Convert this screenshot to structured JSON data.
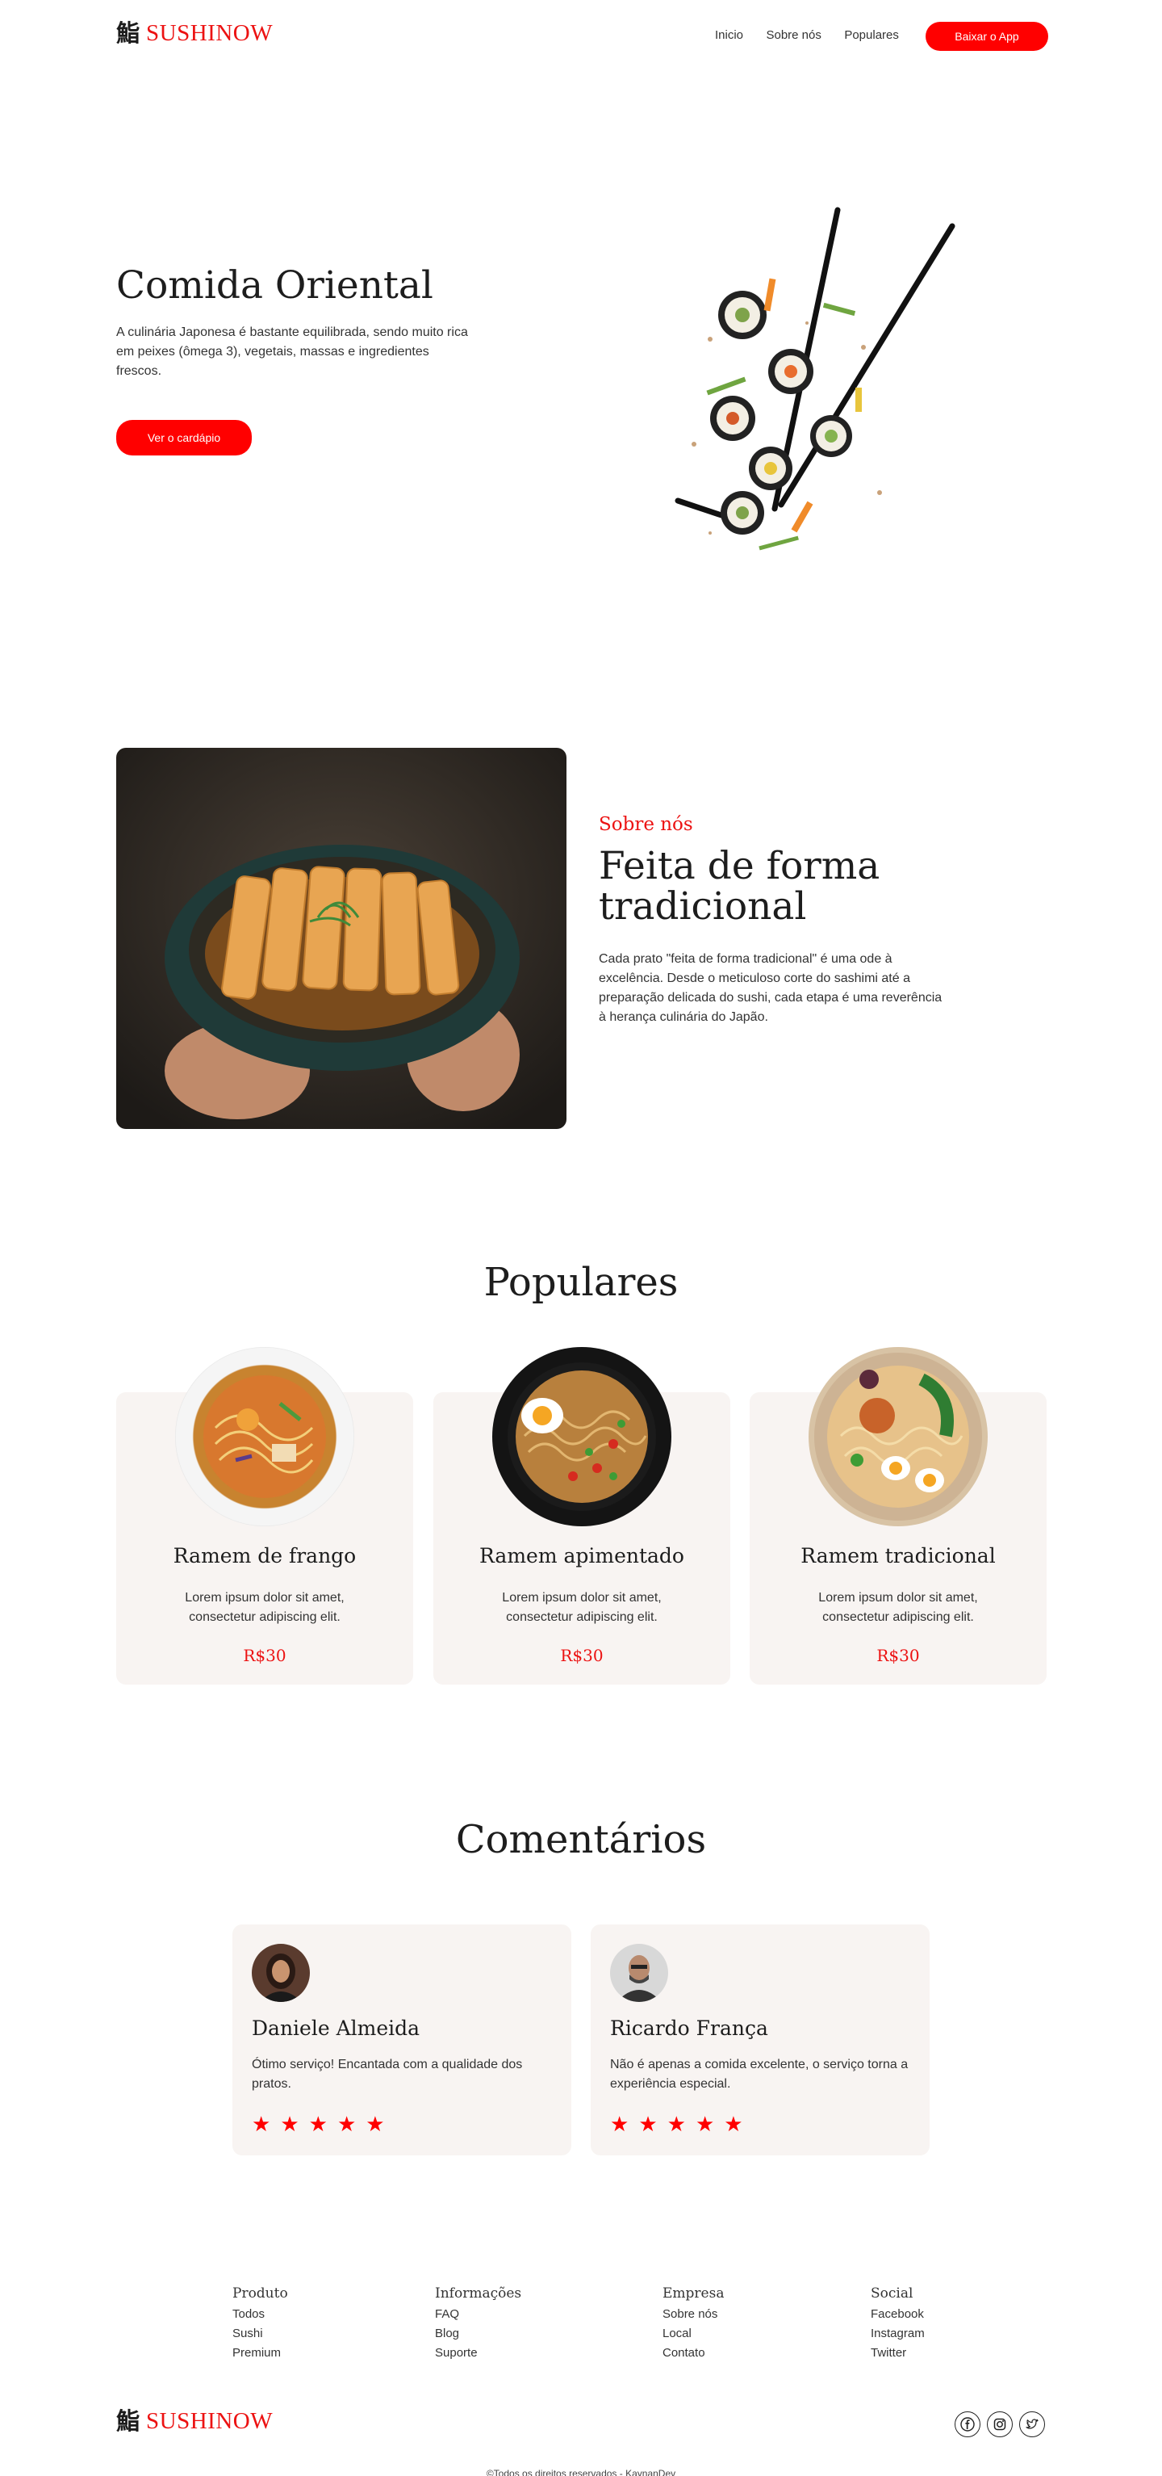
{
  "header": {
    "logo_kanji": "鮨",
    "logo_text": "SUSHINOW",
    "nav": [
      "Inicio",
      "Sobre nós",
      "Populares"
    ],
    "cta": "Baixar o App"
  },
  "hero": {
    "title": "Comida Oriental",
    "description": "A culinária Japonesa é bastante equilibrada, sendo muito rica em peixes (ômega 3), vegetais, massas e ingredientes frescos.",
    "button": "Ver o cardápio",
    "image": "sushi-chopsticks-image"
  },
  "about": {
    "kicker": "Sobre nós",
    "title": "Feita de forma tradicional",
    "description": "Cada prato \"feita de forma tradicional\" é uma ode à excelência. Desde o meticuloso corte do sashimi até a preparação delicada do sushi, cada etapa é uma reverência à herança culinária do Japão.",
    "image": "katsu-bowl-image"
  },
  "populares": {
    "title": "Populares",
    "items": [
      {
        "name": "Ramem de frango",
        "description": "Lorem ipsum dolor sit amet, consectetur adipiscing elit.",
        "price": "R$30"
      },
      {
        "name": "Ramem apimentado",
        "description": "Lorem ipsum dolor sit amet, consectetur adipiscing elit.",
        "price": "R$30"
      },
      {
        "name": "Ramem tradicional",
        "description": "Lorem ipsum dolor sit amet, consectetur adipiscing elit.",
        "price": "R$30"
      }
    ]
  },
  "comentarios": {
    "title": "Comentários",
    "items": [
      {
        "name": "Daniele Almeida",
        "text": "Ótimo serviço! Encantada com a qualidade dos pratos.",
        "rating": 5
      },
      {
        "name": "Ricardo França",
        "text": "Não é apenas a comida excelente, o serviço torna a experiência especial.",
        "rating": 5
      }
    ]
  },
  "footer": {
    "columns": [
      {
        "title": "Produto",
        "links": [
          "Todos",
          "Sushi",
          "Premium"
        ]
      },
      {
        "title": "Informações",
        "links": [
          "FAQ",
          "Blog",
          "Suporte"
        ]
      },
      {
        "title": "Empresa",
        "links": [
          "Sobre nós",
          "Local",
          "Contato"
        ]
      },
      {
        "title": "Social",
        "links": [
          "Facebook",
          "Instagram",
          "Twitter"
        ]
      }
    ],
    "social_icons": [
      "facebook-icon",
      "instagram-icon",
      "twitter-icon"
    ],
    "copyright": "©Todos os direitos reservados - KaynanDev"
  },
  "colors": {
    "accent": "#ff0000",
    "card_bg": "#f8f4f2",
    "text": "#1d1d1d"
  }
}
